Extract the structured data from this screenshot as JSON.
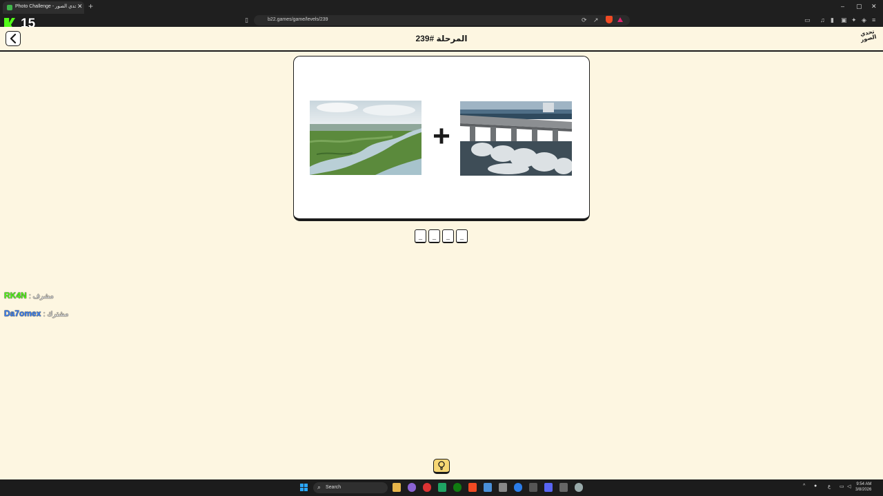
{
  "browser": {
    "tab_title": "Photo Challenge - تحدي الصور",
    "tab_close": "✕",
    "new_tab": "+",
    "url": "b22.games/game/levels/239",
    "window_controls": [
      "–",
      "▢",
      "✕"
    ]
  },
  "overlay": {
    "viewer_count": "15"
  },
  "game": {
    "level_title": "المرحلة #239",
    "logo_text": "تحدي الصور",
    "plus_sign": "+",
    "answer_slots": [
      "_",
      "_",
      "_",
      "_"
    ],
    "images": [
      "river-landscape",
      "dam-spillway"
    ]
  },
  "players": [
    {
      "name": "RK4N",
      "role": ": مشرف",
      "color": "#53fc18"
    },
    {
      "name": "Da7omex",
      "role": ": مشترك",
      "color": "#3b82f6"
    }
  ],
  "taskbar": {
    "search_label": "Search",
    "time": "9:54 AM",
    "date": "3/8/2026"
  }
}
